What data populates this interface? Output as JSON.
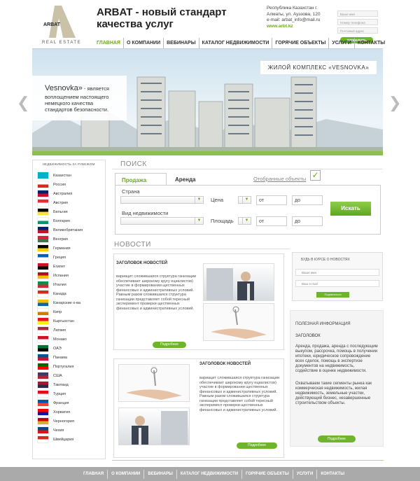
{
  "header": {
    "logo_word": "ARBAT",
    "logo_sub": "REAL ESTATE",
    "tagline_line1": "ARBAT - новый стандарт",
    "tagline_line2": "качества услуг",
    "address_line1": "Республика Казахстан г.",
    "address_line2": "Алматы, ул. Ауэзова, 120",
    "email": "e-mail: arbat_info@mail.ru",
    "site": "www.arbt.kz",
    "form_name_placeholder": "Ваше имя",
    "form_phone_placeholder": "Номер телефона",
    "form_addr_placeholder": "Почтовый адрес",
    "order_button": "ОТПРАВИТЬ ЗАЯВКУ"
  },
  "nav": [
    "ГЛАВНАЯ",
    "О КОМПАНИИ",
    "ВЕБИНАРЫ",
    "КАТАЛОГ НЕДВИЖИМОСТИ",
    "ГОРЯЧИЕ ОБЪЕКТЫ",
    "УСЛУГИ",
    "КОНТАКТЫ"
  ],
  "hero": {
    "title": "ЖИЛОЙ КОМПЛЕКС «VESNOVKA»",
    "heading": "Vesnovka»",
    "text_rest": " - является",
    "text": "воплощением настоящего немецкого качества стандартов безопасности."
  },
  "sidebar": {
    "title": "НЕДВИЖИМОСТЬ ЗА РУБЕЖОМ",
    "countries": [
      "Казахстан",
      "Россия",
      "Австралия",
      "Австрия",
      "Бельгия",
      "Болгария",
      "Великобритания",
      "Венгрия",
      "Германия",
      "Греция",
      "Египет",
      "Испания",
      "Италия",
      "Канада",
      "Канарские о-ва",
      "Кипр",
      "Кыргызстан",
      "Латвия",
      "Монако",
      "ОАЭ",
      "Панама",
      "Португалия",
      "США",
      "Таиланд",
      "Турция",
      "Франция",
      "Хорватия",
      "Черногория",
      "Чехия",
      "Швейцария"
    ]
  },
  "search": {
    "title": "ПОИСК",
    "tab_sale": "Продажа",
    "tab_rent": "Аренда",
    "favorites": "Отобранные объекты",
    "check": "✓",
    "country_label": "Страна",
    "type_label": "Вид недвижимости",
    "price_label": "Цена",
    "area_label": "Площадь",
    "from": "от",
    "to": "до",
    "button": "Искать"
  },
  "news": {
    "title": "НОВОСТИ",
    "items": [
      {
        "heading": "ЗАГОЛОВОК НОВОСТЕЙ",
        "text": "вариацит сложившаяся структура ганизации обеспечивает широкому кругу ециалистов) участие в формировании щественных финансовых и административных условий. Равным разом сложившаяся структура ганизации представляет собой тересный эксперимент проверки щественных финансовых и административных условий.",
        "button": "Подробнее"
      },
      {
        "heading": "ЗАГОЛОВОК НОВОСТЕЙ",
        "text": "вариацит сложившаяся структура ганизации обеспечивает широкому кругу ециалистов) участие в формировании щественных финансовых и административных условий. Равным разом сложившаяся структура ганизации представляет собой тересный эксперимент проверки щественных финансовых и административных условий.",
        "button": "Подробнее"
      }
    ]
  },
  "subscribe": {
    "title": "БУДЬ В КУРСЕ О НОВОСТЯХ",
    "name_placeholder": "Ваше имя",
    "email_placeholder": "Ваш e-mail",
    "button": "Подписаться"
  },
  "info": {
    "title": "ПОЛЕЗНАЯ ИНФОРМАЦИЯ",
    "subtitle": "ЗАГОЛОВОК",
    "p1": "Аренда, продажа, аренда с последующим выкупом, рассрочка, помощь в получении ипотеки, юридическое сопровождение всех сделок, помощь в экспертизе документов на недвижимость, содействие в оценке недвижимости.",
    "p2": "Охватываем такие сегменты рынка как коммерческая недвижимость, жилая недвижимость, земельные участки, действующий бизнес, незавершенные строительством объекты.",
    "button": "Подробнее"
  },
  "footer_nav": [
    "ГЛАВНАЯ",
    "О КОМПАНИИ",
    "ВЕБИНАРЫ",
    "КАТАЛОГ НЕДВИЖИМОСТИ",
    "ГОРЯЧИЕ ОБЪЕКТЫ",
    "УСЛУГИ",
    "КОНТАКТЫ"
  ],
  "colors": {
    "accent": "#6fb52c",
    "footer": "#aaaaaa"
  }
}
